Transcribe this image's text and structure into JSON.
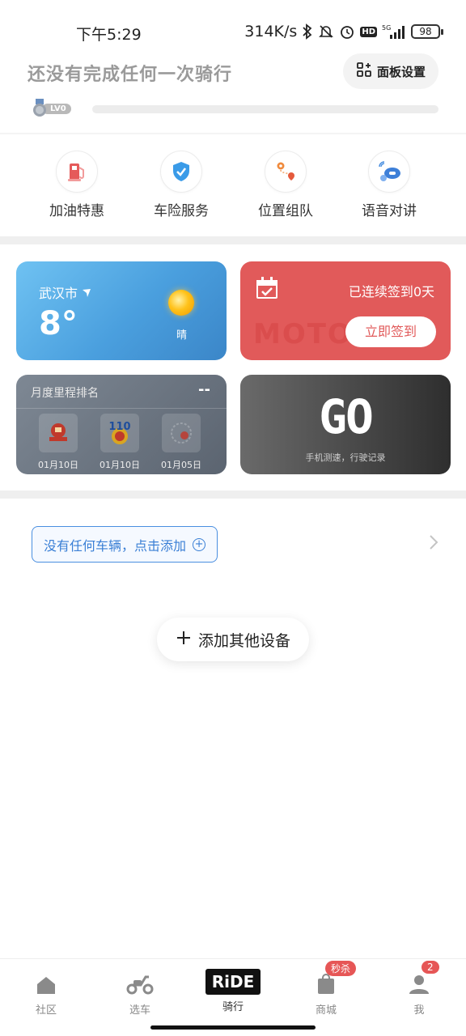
{
  "status_bar": {
    "time": "下午5:29",
    "speed": "314K/s",
    "battery": "98",
    "icons": [
      "bluetooth-icon",
      "mute-icon",
      "alarm-icon",
      "hd-icon",
      "signal-5g-icon"
    ],
    "hd": "HD"
  },
  "header": {
    "title": "还没有完成任何一次骑行",
    "panel_button": "面板设置",
    "level": "LV0"
  },
  "quick_actions": [
    {
      "label": "加油特惠",
      "icon": "fuel-pump-icon",
      "color": "#e55a5a"
    },
    {
      "label": "车险服务",
      "icon": "shield-check-icon",
      "color": "#3a9be8"
    },
    {
      "label": "位置组队",
      "icon": "route-pin-icon",
      "color": "#f08a3c"
    },
    {
      "label": "语音对讲",
      "icon": "intercom-icon",
      "color": "#4a8fe0"
    }
  ],
  "weather": {
    "city": "武汉市",
    "temperature": "8°",
    "condition": "晴"
  },
  "signin": {
    "status": "已连续签到0天",
    "button": "立即签到",
    "watermark": "MOTO"
  },
  "ranking": {
    "title": "月度里程排名",
    "value": "--",
    "items": [
      {
        "date": "01月10日",
        "icon": "badge-red-icon"
      },
      {
        "date": "01月10日",
        "icon": "badge-110-icon"
      },
      {
        "date": "01月05日",
        "icon": "badge-circle-icon"
      }
    ]
  },
  "go_card": {
    "big": "GO",
    "sub": "手机测速，行驶记录"
  },
  "vehicle": {
    "add_text": "没有任何车辆，点击添加"
  },
  "add_device": {
    "label": "添加其他设备"
  },
  "bottom_nav": {
    "items": [
      {
        "label": "社区",
        "icon": "home-icon"
      },
      {
        "label": "选车",
        "icon": "scooter-icon"
      },
      {
        "label": "骑行",
        "icon": "ride-logo",
        "logo": "RiDE"
      },
      {
        "label": "商城",
        "icon": "shopping-bag-icon",
        "badge": "秒杀"
      },
      {
        "label": "我",
        "icon": "person-icon",
        "badge": "2"
      }
    ]
  }
}
